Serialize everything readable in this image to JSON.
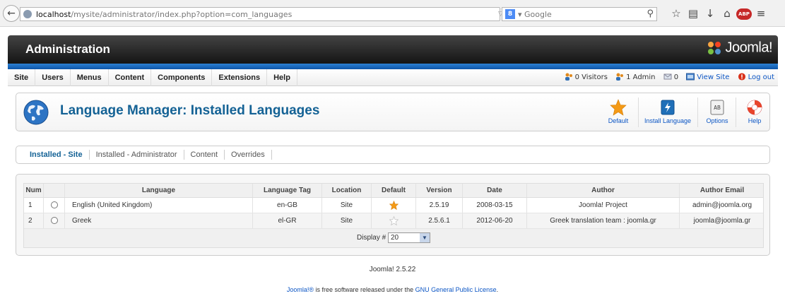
{
  "browser": {
    "url_host": "localhost",
    "url_path": "/mysite/administrator/index.php?option=com_languages",
    "search_engine": "Google"
  },
  "header": {
    "title": "Administration",
    "logo_text": "Joomla!"
  },
  "menu": {
    "items": [
      "Site",
      "Users",
      "Menus",
      "Content",
      "Components",
      "Extensions",
      "Help"
    ]
  },
  "status": {
    "visitors": "0 Visitors",
    "admins": "1 Admin",
    "messages": "0",
    "view_site": "View Site",
    "logout": "Log out"
  },
  "page": {
    "title": "Language Manager: Installed Languages"
  },
  "toolbar": {
    "default_label": "Default",
    "install_label": "Install Language",
    "options_label": "Options",
    "help_label": "Help"
  },
  "tabs": [
    "Installed - Site",
    "Installed - Administrator",
    "Content",
    "Overrides"
  ],
  "table": {
    "headers": [
      "Num",
      "",
      "Language",
      "Language Tag",
      "Location",
      "Default",
      "Version",
      "Date",
      "Author",
      "Author Email"
    ],
    "rows": [
      {
        "num": "1",
        "language": "English (United Kingdom)",
        "tag": "en-GB",
        "location": "Site",
        "default": true,
        "version": "2.5.19",
        "date": "2008-03-15",
        "author": "Joomla! Project",
        "email": "admin@joomla.org"
      },
      {
        "num": "2",
        "language": "Greek",
        "tag": "el-GR",
        "location": "Site",
        "default": false,
        "version": "2.5.6.1",
        "date": "2012-06-20",
        "author": "Greek translation team : joomla.gr",
        "email": "joomla@joomla.gr"
      }
    ]
  },
  "pager": {
    "label": "Display #",
    "value": "20"
  },
  "footer": {
    "version": "Joomla! 2.5.22",
    "license_link1": "Joomla!®",
    "license_text": " is free software released under the ",
    "license_link2": "GNU General Public License",
    "license_end": "."
  },
  "colors": {
    "title_blue": "#146295",
    "link_blue": "#0b55c4",
    "header_dark": "#141414",
    "bar_blue": "#1565b8",
    "star_orange": "#f49a16"
  }
}
